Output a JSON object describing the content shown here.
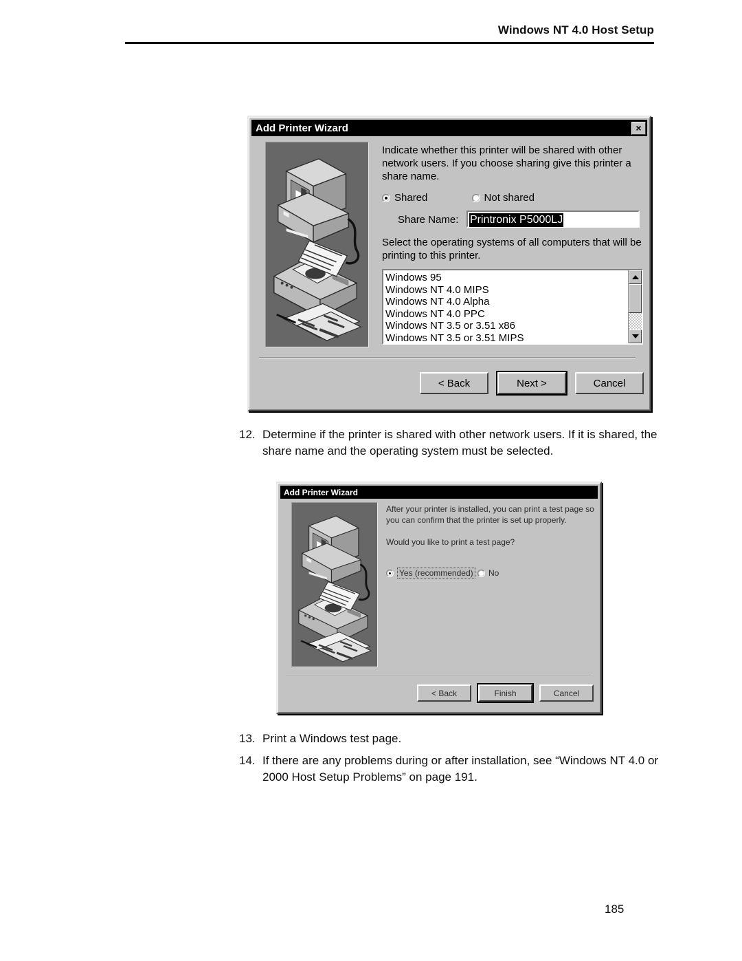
{
  "page": {
    "header_title": "Windows NT 4.0 Host Setup",
    "page_number": "185"
  },
  "dialog1": {
    "title": "Add Printer Wizard",
    "close_icon": "close-icon",
    "close_label": "×",
    "illustration": "computer-printer-illustration",
    "body_text": "Indicate whether this printer will be shared with other network users.  If you choose sharing give this printer a share name.",
    "radio_shared": "Shared",
    "radio_not_shared": "Not shared",
    "shared_selected": true,
    "share_name_label": "Share Name:",
    "share_name_value": "Printronix P5000LJ",
    "body_text2": "Select the operating systems of all computers that will be printing to this printer.",
    "os_list": [
      "Windows 95",
      "Windows NT 4.0 MIPS",
      "Windows NT 4.0 Alpha",
      "Windows NT 4.0 PPC",
      "Windows NT 3.5 or 3.51 x86",
      "Windows NT 3.5 or 3.51 MIPS"
    ],
    "scroll_up_icon": "scroll-up-arrow-icon",
    "scroll_down_icon": "scroll-down-arrow-icon",
    "buttons": {
      "back": "< Back",
      "next": "Next >",
      "cancel": "Cancel",
      "default": "Next >"
    }
  },
  "dialog2": {
    "title": "Add Printer Wizard",
    "illustration": "computer-printer-illustration",
    "body_text": "After your printer is installed, you can print a test page so you can confirm that the printer is set up properly.",
    "body_text2": "Would you like to print a test page?",
    "radio_yes": "Yes (recommended)",
    "radio_no": "No",
    "yes_selected": true,
    "buttons": {
      "back": "< Back",
      "finish": "Finish",
      "cancel": "Cancel",
      "default": "Finish"
    }
  },
  "steps": [
    {
      "num": "12.",
      "text": "Determine if the printer is shared with other network users. If it is shared, the share name and the operating system must be selected."
    },
    {
      "num": "13.",
      "text": "Print a Windows test page."
    },
    {
      "num": "14.",
      "text": "If there are any problems during or after installation, see “Windows NT 4.0 or 2000 Host Setup Problems” on page 191."
    }
  ]
}
